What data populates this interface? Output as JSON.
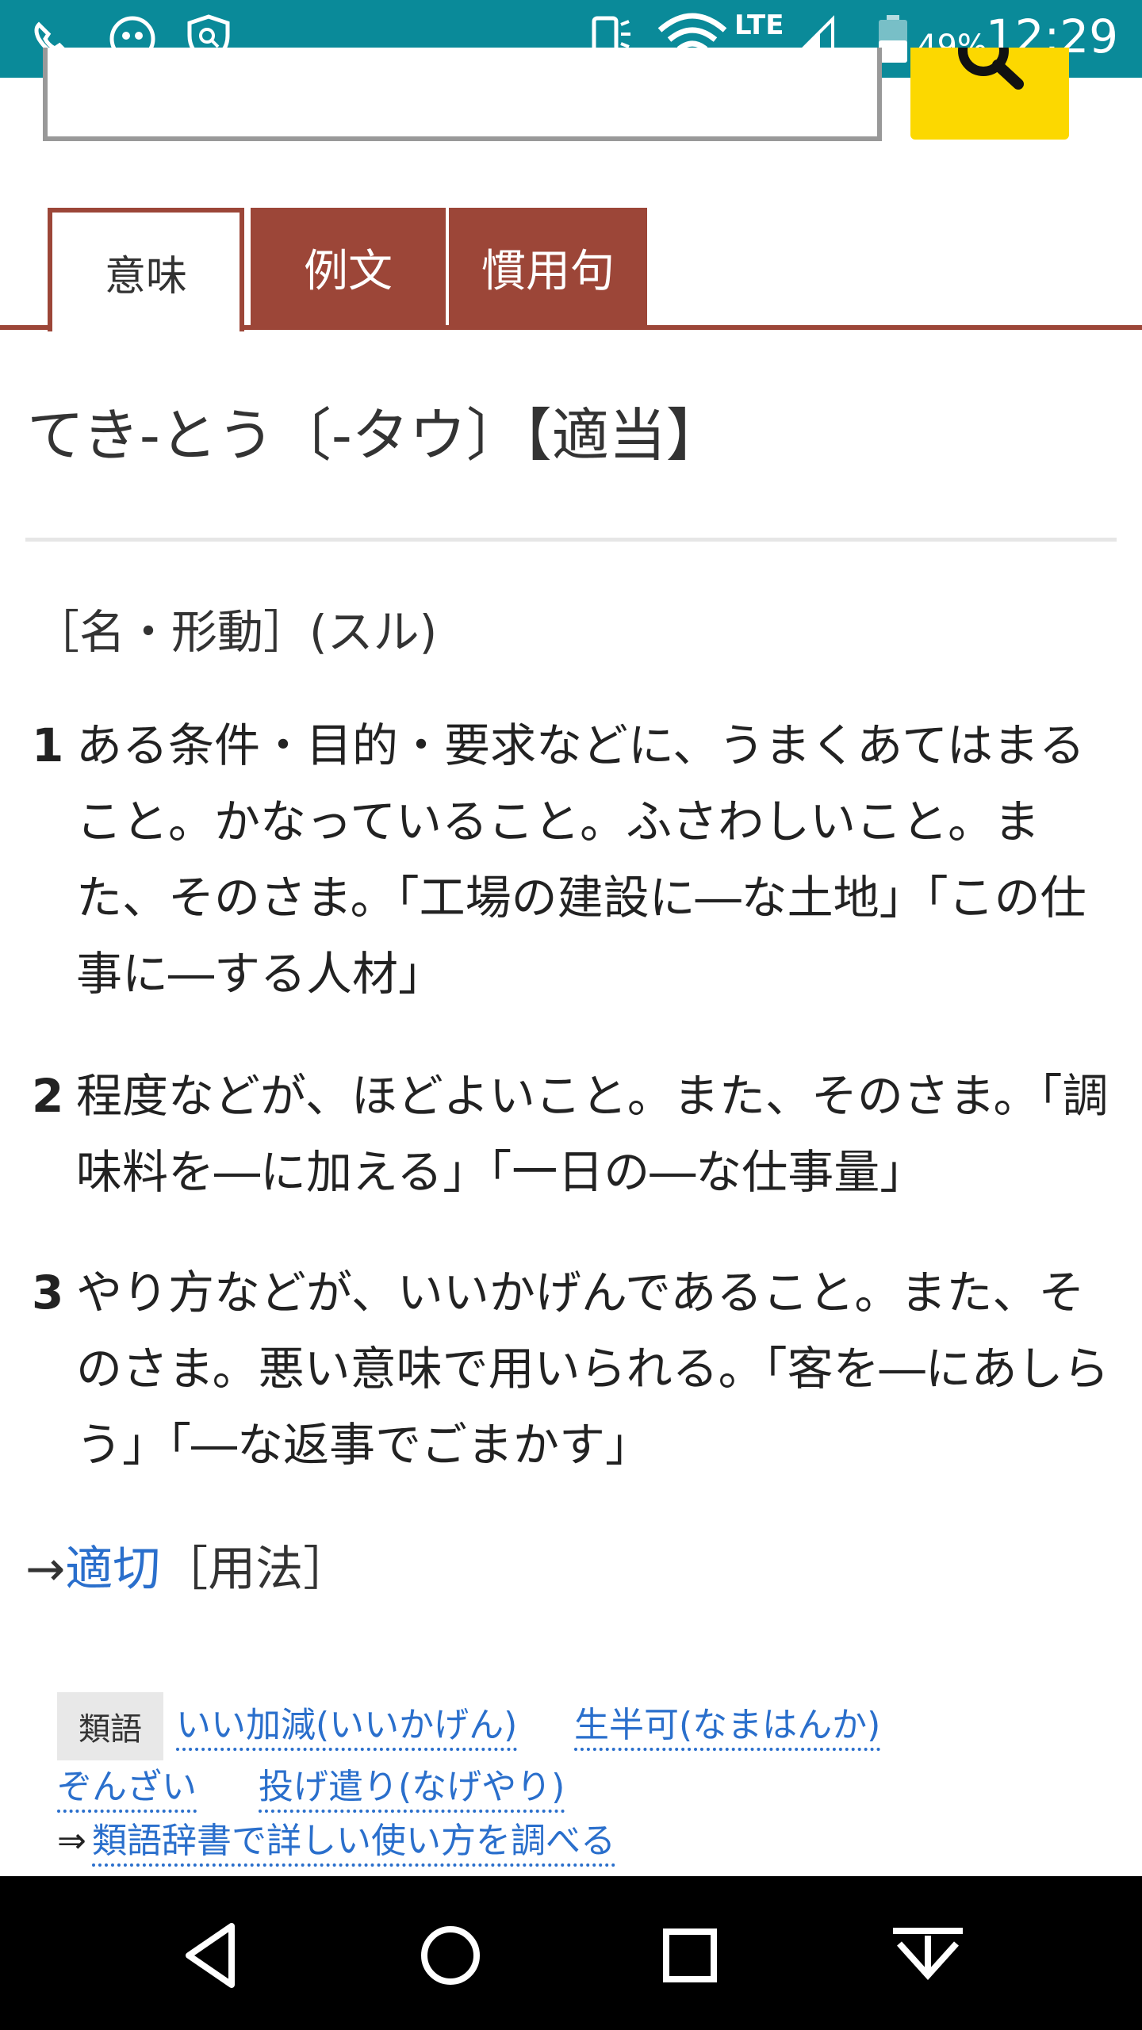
{
  "status_bar": {
    "time": "12:29",
    "battery_percent": "49%",
    "network": "LTE",
    "icons": [
      "volte-on-icon",
      "assistant-mascot-icon",
      "shield-search-icon",
      "vibrate-icon",
      "wifi-icon",
      "signal-icon",
      "battery-icon"
    ]
  },
  "tabs": [
    {
      "label": "意味",
      "active": true
    },
    {
      "label": "例文",
      "active": false
    },
    {
      "label": "慣用句",
      "active": false
    }
  ],
  "entry": {
    "title": "てき‐とう〔‐タウ〕【適当】",
    "part_of_speech": "［名・形動］(スル)",
    "senses": [
      {
        "num": "1",
        "text": "ある条件・目的・要求などに、うまくあてはまること。かなっていること。ふさわしいこと。また、そのさま。「工場の建設に―な土地」「この仕事に―する人材」"
      },
      {
        "num": "2",
        "text": "程度などが、ほどよいこと。また、そのさま。「調味料を―に加える」「一日の―な仕事量」"
      },
      {
        "num": "3",
        "text": "やり方などが、いいかげんであること。また、そのさま。悪い意味で用いられる。「客を―にあしらう」「―な返事でごまかす」"
      }
    ],
    "crossref": {
      "arrow": "→",
      "link": "適切",
      "suffix": "［用法］"
    }
  },
  "synonyms": {
    "badge": "類語",
    "items": [
      "いい加減(いいかげん)",
      "生半可(なまはんか)",
      "ぞんざい",
      "投げ遣り(なげやり)"
    ],
    "more_prefix": "⇒",
    "more_link": "類語辞書で詳しい使い方を調べる"
  },
  "colors": {
    "status_bar": "#0a8a99",
    "tab_accent": "#9c4638",
    "search_button": "#fcd800",
    "link": "#2a6fcc"
  }
}
